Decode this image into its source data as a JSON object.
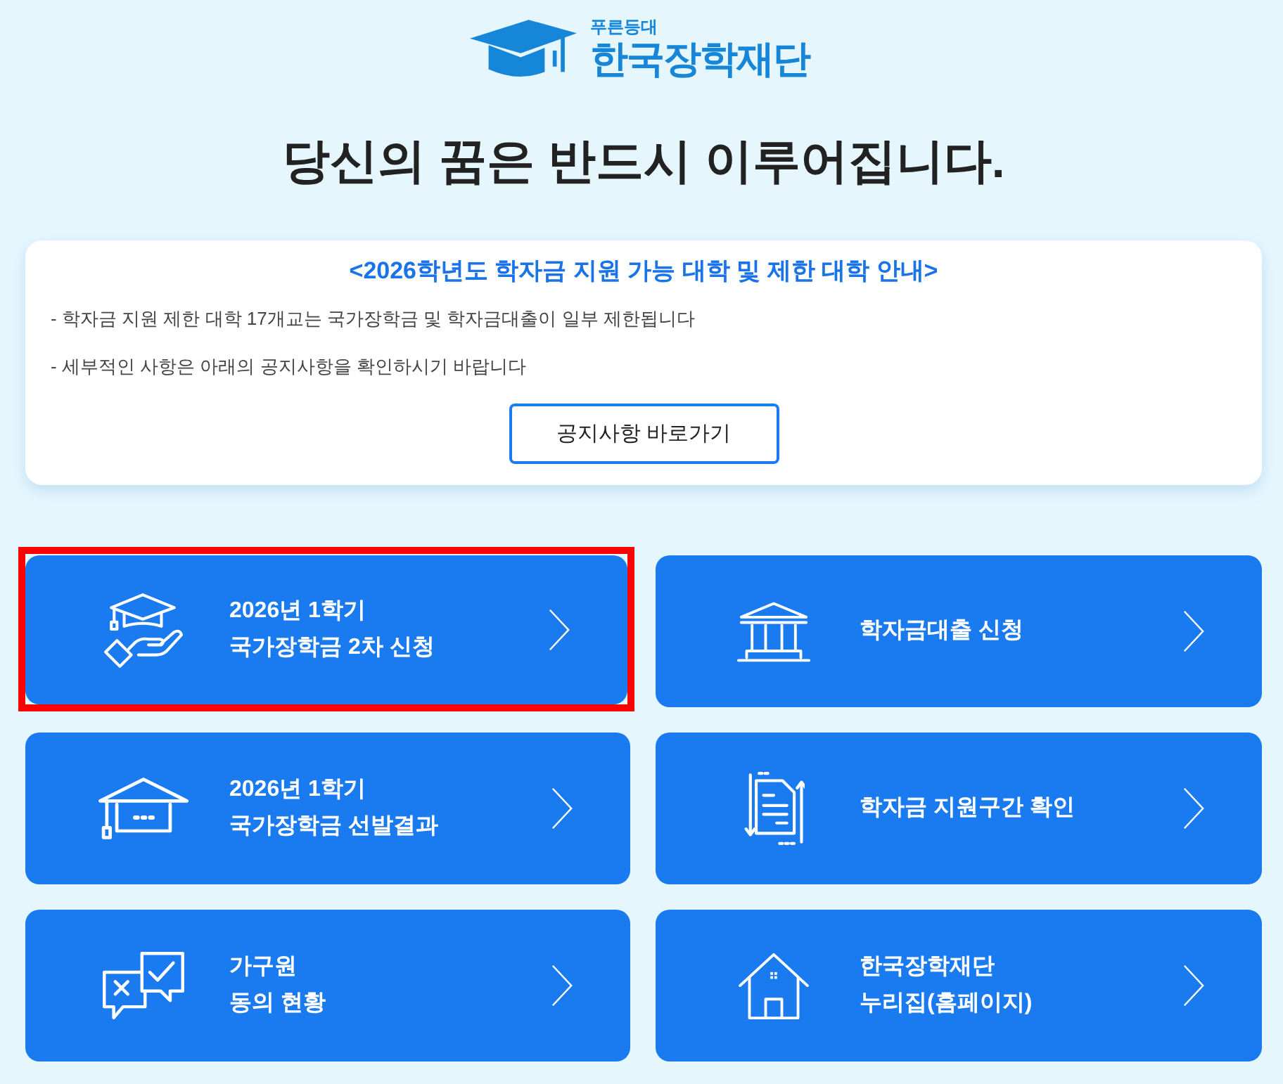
{
  "logo": {
    "tagline": "푸른등대",
    "name": "한국장학재단"
  },
  "headline": "당신의 꿈은 반드시 이루어집니다.",
  "notice": {
    "title": "<2026학년도 학자금 지원 가능 대학 및 제한 대학 안내>",
    "lines": [
      "- 학자금 지원 제한 대학 17개교는 국가장학금 및 학자금대출이 일부 제한됩니다",
      "- 세부적인 사항은 아래의 공지사항을 확인하시기 바랍니다"
    ],
    "button": "공지사항 바로가기"
  },
  "tiles": [
    {
      "lines": [
        "2026년 1학기",
        "국가장학금 2차 신청"
      ],
      "selected": true
    },
    {
      "lines": [
        "학자금대출 신청"
      ],
      "selected": false
    },
    {
      "lines": [
        "2026년 1학기",
        "국가장학금 선발결과"
      ],
      "selected": false
    },
    {
      "lines": [
        "학자금 지원구간 확인"
      ],
      "selected": false
    },
    {
      "lines": [
        "가구원",
        "동의 현황"
      ],
      "selected": false
    },
    {
      "lines": [
        "한국장학재단",
        "누리집(홈페이지)"
      ],
      "selected": false
    }
  ]
}
